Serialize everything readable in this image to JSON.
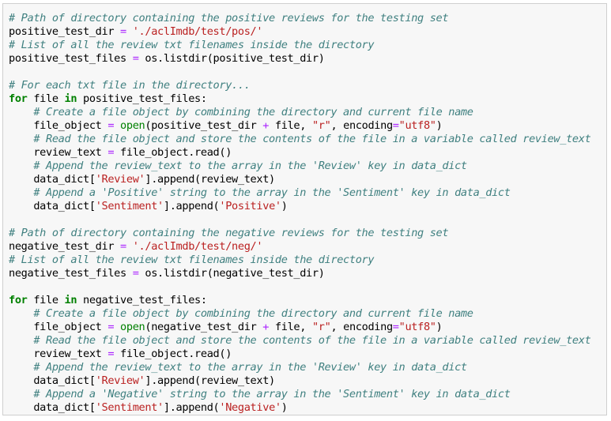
{
  "cell": {
    "language": "python",
    "lines": [
      [
        {
          "t": "comment",
          "v": "# Path of directory containing the positive reviews for the testing set"
        }
      ],
      [
        {
          "t": "plain",
          "v": "positive_test_dir "
        },
        {
          "t": "op",
          "v": "="
        },
        {
          "t": "plain",
          "v": " "
        },
        {
          "t": "string",
          "v": "'./aclImdb/test/pos/'"
        }
      ],
      [
        {
          "t": "comment",
          "v": "# List of all the review txt filenames inside the directory"
        }
      ],
      [
        {
          "t": "plain",
          "v": "positive_test_files "
        },
        {
          "t": "op",
          "v": "="
        },
        {
          "t": "plain",
          "v": " os.listdir(positive_test_dir)"
        }
      ],
      [],
      [
        {
          "t": "comment",
          "v": "# For each txt file in the directory..."
        }
      ],
      [
        {
          "t": "keyword",
          "v": "for"
        },
        {
          "t": "plain",
          "v": " file "
        },
        {
          "t": "keyword",
          "v": "in"
        },
        {
          "t": "plain",
          "v": " positive_test_files:"
        }
      ],
      [
        {
          "t": "plain",
          "v": "    "
        },
        {
          "t": "comment",
          "v": "# Create a file object by combining the directory and current file name"
        }
      ],
      [
        {
          "t": "plain",
          "v": "    file_object "
        },
        {
          "t": "op",
          "v": "="
        },
        {
          "t": "plain",
          "v": " "
        },
        {
          "t": "builtin",
          "v": "open"
        },
        {
          "t": "plain",
          "v": "(positive_test_dir "
        },
        {
          "t": "op",
          "v": "+"
        },
        {
          "t": "plain",
          "v": " file, "
        },
        {
          "t": "string",
          "v": "\"r\""
        },
        {
          "t": "plain",
          "v": ", encoding"
        },
        {
          "t": "op",
          "v": "="
        },
        {
          "t": "string",
          "v": "\"utf8\""
        },
        {
          "t": "plain",
          "v": ")"
        }
      ],
      [
        {
          "t": "plain",
          "v": "    "
        },
        {
          "t": "comment",
          "v": "# Read the file object and store the contents of the file in a variable called review_text"
        }
      ],
      [
        {
          "t": "plain",
          "v": "    review_text "
        },
        {
          "t": "op",
          "v": "="
        },
        {
          "t": "plain",
          "v": " file_object.read()"
        }
      ],
      [
        {
          "t": "plain",
          "v": "    "
        },
        {
          "t": "comment",
          "v": "# Append the review_text to the array in the 'Review' key in data_dict"
        }
      ],
      [
        {
          "t": "plain",
          "v": "    data_dict["
        },
        {
          "t": "string",
          "v": "'Review'"
        },
        {
          "t": "plain",
          "v": "].append(review_text)"
        }
      ],
      [
        {
          "t": "plain",
          "v": "    "
        },
        {
          "t": "comment",
          "v": "# Append a 'Positive' string to the array in the 'Sentiment' key in data_dict"
        }
      ],
      [
        {
          "t": "plain",
          "v": "    data_dict["
        },
        {
          "t": "string",
          "v": "'Sentiment'"
        },
        {
          "t": "plain",
          "v": "].append("
        },
        {
          "t": "string",
          "v": "'Positive'"
        },
        {
          "t": "plain",
          "v": ")"
        }
      ],
      [],
      [
        {
          "t": "comment",
          "v": "# Path of directory containing the negative reviews for the testing set"
        }
      ],
      [
        {
          "t": "plain",
          "v": "negative_test_dir "
        },
        {
          "t": "op",
          "v": "="
        },
        {
          "t": "plain",
          "v": " "
        },
        {
          "t": "string",
          "v": "'./aclImdb/test/neg/'"
        }
      ],
      [
        {
          "t": "comment",
          "v": "# List of all the review txt filenames inside the directory"
        }
      ],
      [
        {
          "t": "plain",
          "v": "negative_test_files "
        },
        {
          "t": "op",
          "v": "="
        },
        {
          "t": "plain",
          "v": " os.listdir(negative_test_dir)"
        }
      ],
      [],
      [
        {
          "t": "keyword",
          "v": "for"
        },
        {
          "t": "plain",
          "v": " file "
        },
        {
          "t": "keyword",
          "v": "in"
        },
        {
          "t": "plain",
          "v": " negative_test_files:"
        }
      ],
      [
        {
          "t": "plain",
          "v": "    "
        },
        {
          "t": "comment",
          "v": "# Create a file object by combining the directory and current file name"
        }
      ],
      [
        {
          "t": "plain",
          "v": "    file_object "
        },
        {
          "t": "op",
          "v": "="
        },
        {
          "t": "plain",
          "v": " "
        },
        {
          "t": "builtin",
          "v": "open"
        },
        {
          "t": "plain",
          "v": "(negative_test_dir "
        },
        {
          "t": "op",
          "v": "+"
        },
        {
          "t": "plain",
          "v": " file, "
        },
        {
          "t": "string",
          "v": "\"r\""
        },
        {
          "t": "plain",
          "v": ", encoding"
        },
        {
          "t": "op",
          "v": "="
        },
        {
          "t": "string",
          "v": "\"utf8\""
        },
        {
          "t": "plain",
          "v": ")"
        }
      ],
      [
        {
          "t": "plain",
          "v": "    "
        },
        {
          "t": "comment",
          "v": "# Read the file object and store the contents of the file in a variable called review_text"
        }
      ],
      [
        {
          "t": "plain",
          "v": "    review_text "
        },
        {
          "t": "op",
          "v": "="
        },
        {
          "t": "plain",
          "v": " file_object.read()"
        }
      ],
      [
        {
          "t": "plain",
          "v": "    "
        },
        {
          "t": "comment",
          "v": "# Append the review_text to the array in the 'Review' key in data_dict"
        }
      ],
      [
        {
          "t": "plain",
          "v": "    data_dict["
        },
        {
          "t": "string",
          "v": "'Review'"
        },
        {
          "t": "plain",
          "v": "].append(review_text)"
        }
      ],
      [
        {
          "t": "plain",
          "v": "    "
        },
        {
          "t": "comment",
          "v": "# Append a 'Negative' string to the array in the 'Sentiment' key in data_dict"
        }
      ],
      [
        {
          "t": "plain",
          "v": "    data_dict["
        },
        {
          "t": "string",
          "v": "'Sentiment'"
        },
        {
          "t": "plain",
          "v": "].append("
        },
        {
          "t": "string",
          "v": "'Negative'"
        },
        {
          "t": "plain",
          "v": ")"
        }
      ]
    ]
  },
  "colors": {
    "comment": "#408080",
    "keyword": "#008000",
    "builtin": "#008000",
    "operator": "#aa22ff",
    "string": "#ba2121",
    "text": "#000000",
    "cell_background": "#f7f7f7",
    "cell_border": "#cfcfcf"
  }
}
